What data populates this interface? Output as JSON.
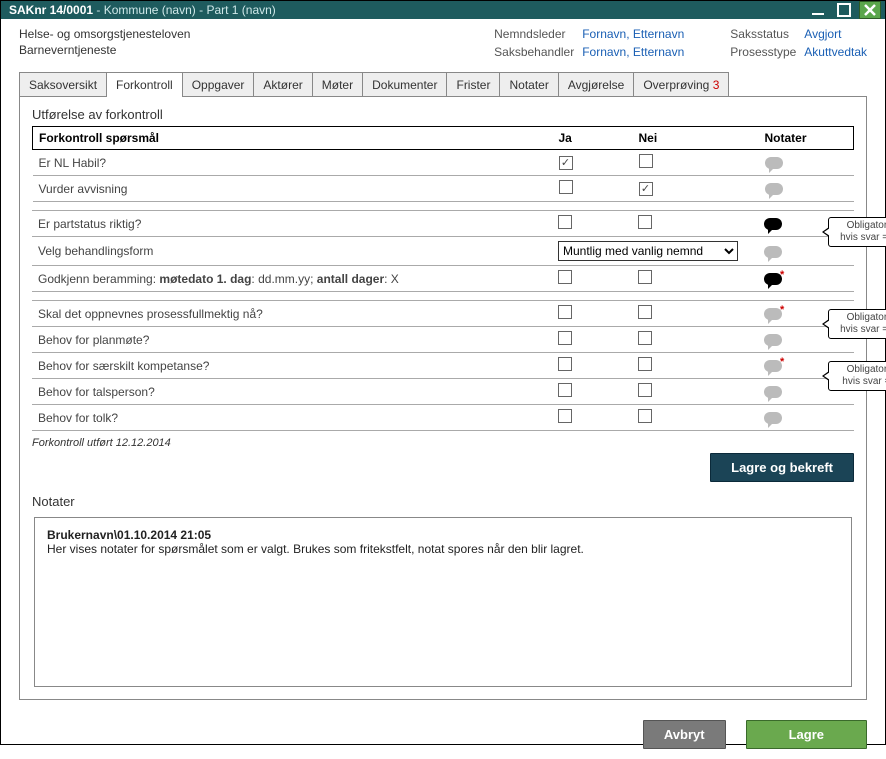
{
  "title": {
    "case": "SAKnr 14/0001",
    "sep": " - ",
    "kommune": "Kommune (navn)",
    "part": "Part 1 (navn)"
  },
  "meta": {
    "left1": "Helse- og omsorgstjenesteloven",
    "left2": "Barneverntjeneste",
    "r1l": "Nemndsleder",
    "r1v": "Fornavn, Etternavn",
    "r2l": "Saksbehandler",
    "r2v": "Fornavn, Etternavn",
    "r3l": "Saksstatus",
    "r3v": "Avgjort",
    "r4l": "Prosesstype",
    "r4v": "Akuttvedtak"
  },
  "tabs": [
    "Saksoversikt",
    "Forkontroll",
    "Oppgaver",
    "Aktører",
    "Møter",
    "Dokumenter",
    "Frister",
    "Notater",
    "Avgjørelse",
    "Overprøving"
  ],
  "overprov_count": "3",
  "section": "Utførelse av forkontroll",
  "cols": {
    "q": "Forkontroll spørsmål",
    "ja": "Ja",
    "nei": "Nei",
    "not": "Notater"
  },
  "rows": {
    "r1": "Er NL Habil?",
    "r2": "Vurder avvisning",
    "r3": "Er partstatus riktig?",
    "r4": "Velg behandlingsform",
    "r4_select": "Muntlig  med vanlig nemnd",
    "r5a": "Godkjenn beramming: ",
    "r5b": "møtedato 1. dag",
    "r5c": ": dd.mm.yy; ",
    "r5d": "antall dager",
    "r5e": ": X",
    "r6": "Skal det oppnevnes prosessfullmektig nå?",
    "r7": "Behov for planmøte?",
    "r8": "Behov for særskilt kompetanse?",
    "r9": "Behov for talsperson?",
    "r10": "Behov for tolk?"
  },
  "callouts": {
    "c1a": "Obligatorisk",
    "c1b": "hvis svar = Nei",
    "c2a": "Obligatorisk",
    "c2b": "hvis svar = Nei",
    "c3a": "Obligatorisk",
    "c3b": "hvis svar = Ja"
  },
  "footer_line": "Forkontroll utført 12.12.2014",
  "btn_save_confirm": "Lagre og bekreft",
  "notes_title": "Notater",
  "notes_hdr": "Brukernavn\\01.10.2014 21:05",
  "notes_body": "Her vises notater for spørsmålet som er valgt. Brukes som fritekstfelt, notat spores når den blir lagret.",
  "btn_cancel": "Avbryt",
  "btn_save": "Lagre"
}
